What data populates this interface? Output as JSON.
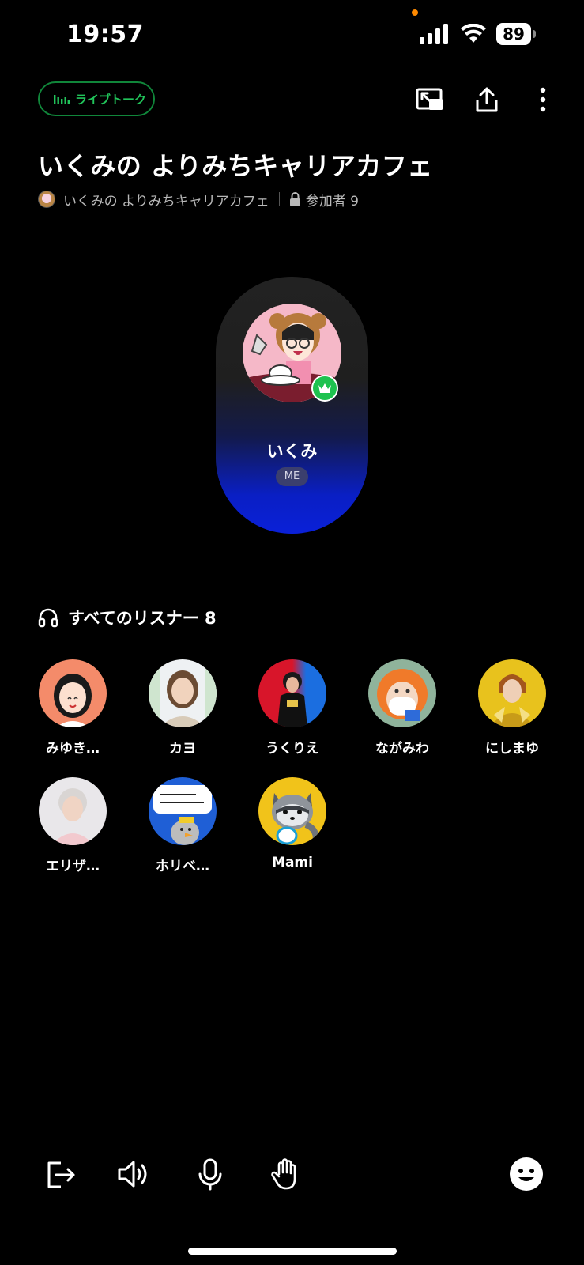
{
  "status_bar": {
    "time": "19:57",
    "battery": "89"
  },
  "header": {
    "live_label": "ライブトーク",
    "title": "いくみの よりみちキャリアカフェ",
    "host_room": "いくみの よりみちキャリアカフェ",
    "participants": "参加者 9"
  },
  "speaker": {
    "name": "いくみ",
    "badge": "ME"
  },
  "listeners": {
    "heading": "すべてのリスナー 8",
    "items": [
      {
        "name": "みゆき…"
      },
      {
        "name": "カヨ"
      },
      {
        "name": "うくりえ"
      },
      {
        "name": "ながみわ"
      },
      {
        "name": "にしまゆ"
      },
      {
        "name": "エリザ…"
      },
      {
        "name": "ホリベ…"
      },
      {
        "name": "Mami"
      }
    ]
  },
  "colors": {
    "accent": "#21c45a",
    "speaker_glow": "#0a20d8"
  },
  "icons": [
    "pip-icon",
    "share-icon",
    "more-icon",
    "headphones-icon",
    "leave-icon",
    "speaker-icon",
    "mic-icon",
    "raise-hand-icon",
    "emoji-icon"
  ]
}
